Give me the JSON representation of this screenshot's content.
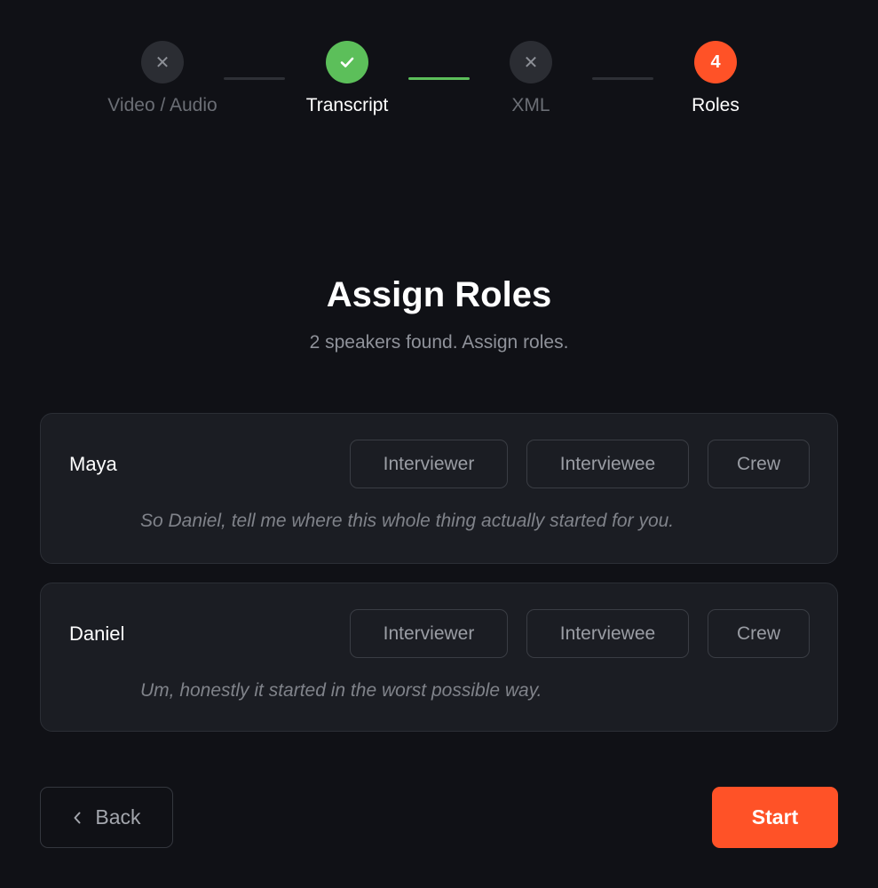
{
  "stepper": {
    "steps": [
      {
        "label": "Video / Audio",
        "state": "skipped",
        "icon": "close-icon",
        "glyph": "✕"
      },
      {
        "label": "Transcript",
        "state": "done",
        "icon": "check-icon"
      },
      {
        "label": "XML",
        "state": "skipped",
        "icon": "close-icon",
        "glyph": "✕"
      },
      {
        "label": "Roles",
        "state": "active",
        "number": "4"
      }
    ],
    "connectors": [
      "incomplete",
      "complete",
      "incomplete"
    ]
  },
  "header": {
    "title": "Assign Roles",
    "subtitle": "2 speakers found. Assign roles."
  },
  "speakers": [
    {
      "name": "Maya",
      "quote": "So Daniel, tell me where this whole thing actually started for you.",
      "roles": [
        "Interviewer",
        "Interviewee",
        "Crew"
      ]
    },
    {
      "name": "Daniel",
      "quote": "Um, honestly it started in the worst possible way.",
      "roles": [
        "Interviewer",
        "Interviewee",
        "Crew"
      ]
    }
  ],
  "footer": {
    "back_label": "Back",
    "start_label": "Start"
  },
  "colors": {
    "background": "#101116",
    "card": "#1b1d23",
    "accent": "#ff5227",
    "success": "#5cbf5a",
    "muted_text": "#8f929a"
  }
}
